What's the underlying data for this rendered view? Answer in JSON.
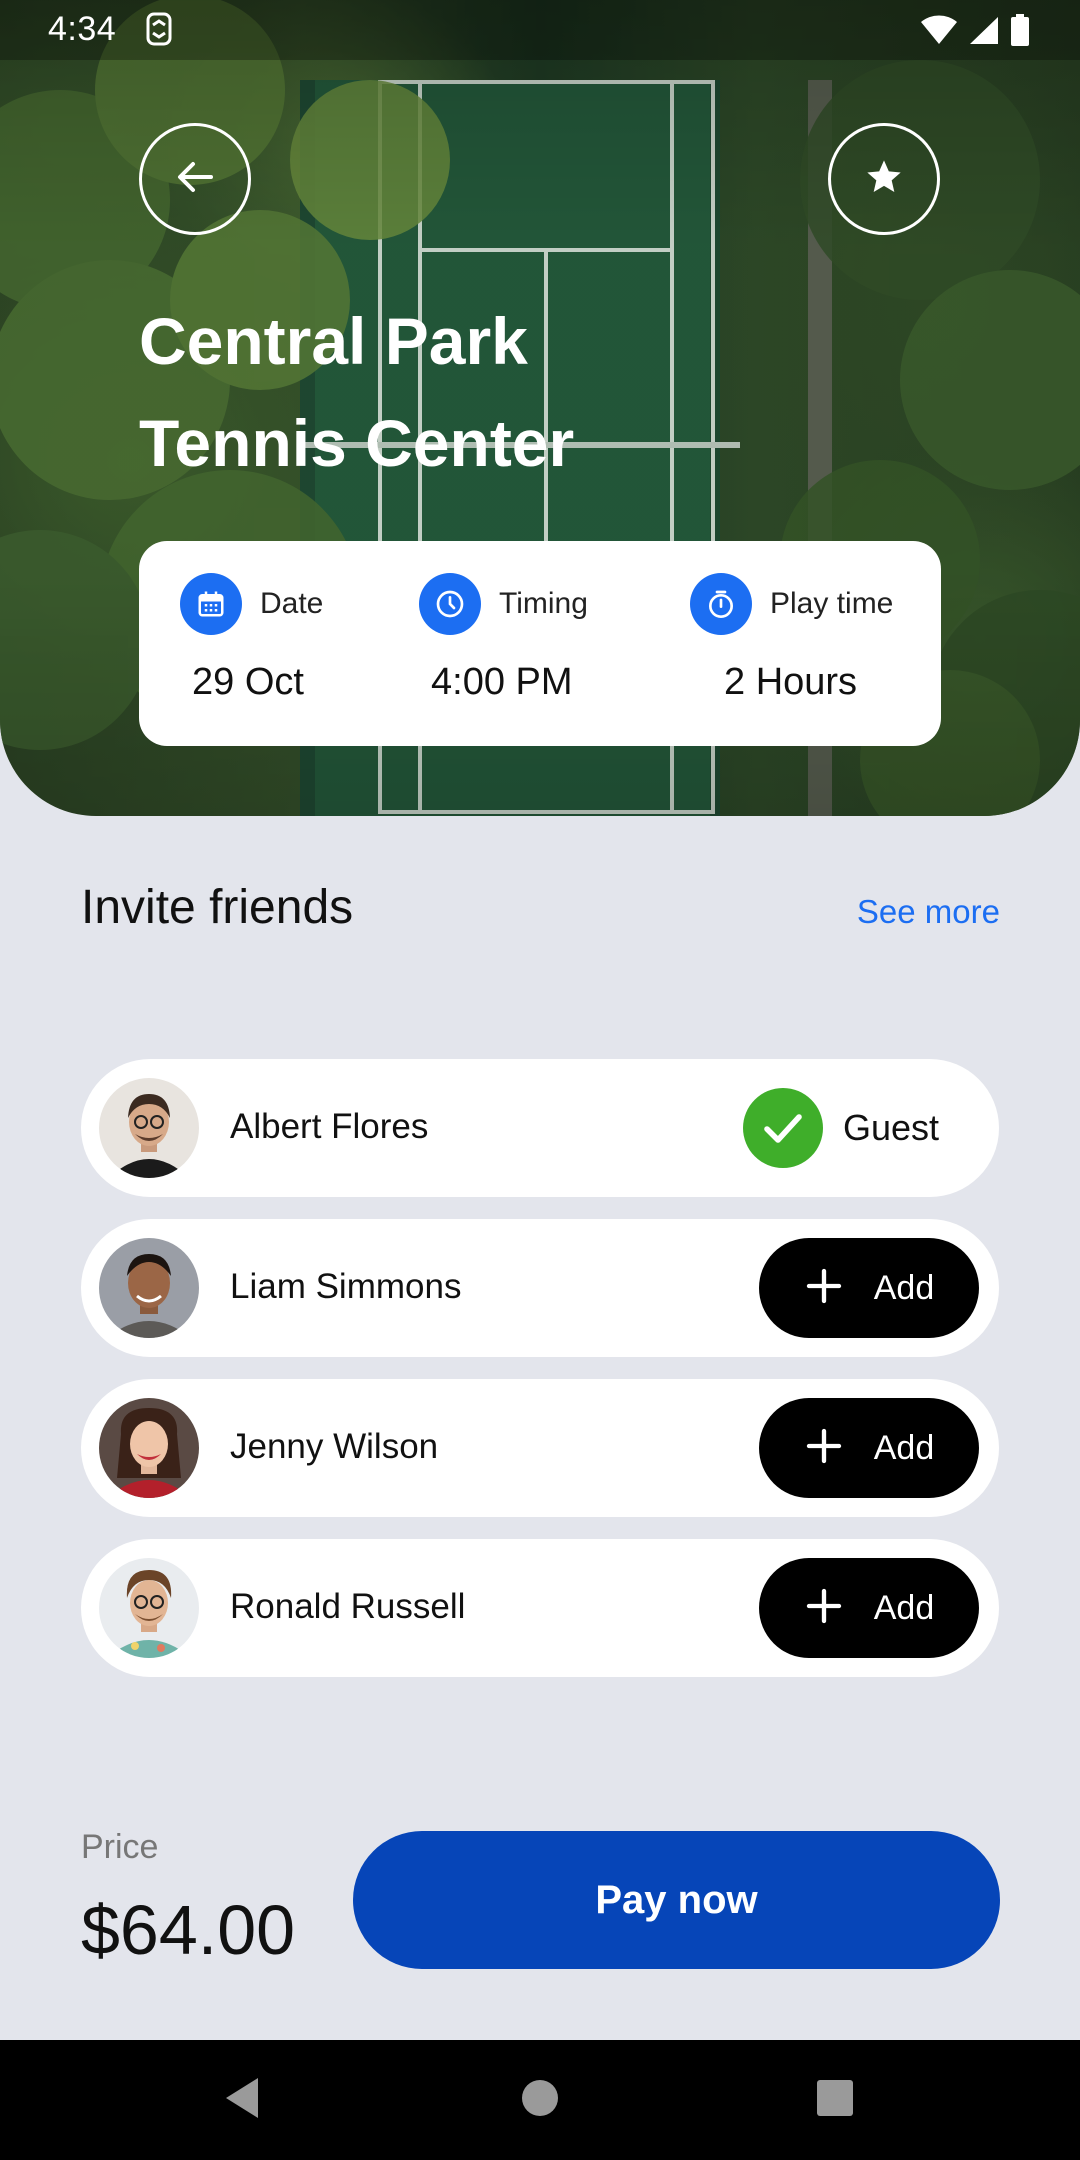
{
  "status_bar": {
    "time": "4:34"
  },
  "venue": {
    "title_line1": "Central Park",
    "title_line2": "Tennis Center"
  },
  "info": {
    "date_label": "Date",
    "date_value": "29 Oct",
    "timing_label": "Timing",
    "timing_value": "4:00 PM",
    "playtime_label": "Play time",
    "playtime_value": "2 Hours"
  },
  "invite": {
    "title": "Invite friends",
    "see_more": "See more",
    "friends": [
      {
        "name": "Albert Flores",
        "status": "Guest"
      },
      {
        "name": "Liam Simmons",
        "action": "Add"
      },
      {
        "name": "Jenny Wilson",
        "action": "Add"
      },
      {
        "name": "Ronald Russell",
        "action": "Add"
      }
    ]
  },
  "checkout": {
    "price_label": "Price",
    "price_value": "$64.00",
    "pay_label": "Pay now"
  },
  "colors": {
    "accent_blue": "#1c6ef2",
    "pay_blue": "#0645b8",
    "guest_green": "#3fae2a"
  }
}
